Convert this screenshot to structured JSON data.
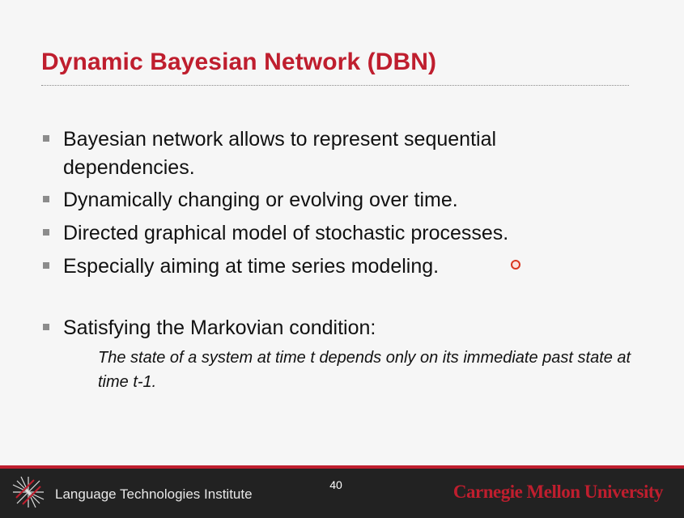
{
  "slide": {
    "title": "Dynamic Bayesian Network (DBN)",
    "bullets": [
      {
        "text": "Bayesian network allows to represent sequential dependencies."
      },
      {
        "text": "Dynamically changing or evolving over time."
      },
      {
        "text": "Directed graphical model of stochastic processes."
      },
      {
        "text": "Especially aiming at time series modeling."
      },
      {
        "text": "Satisfying the Markovian condition:"
      }
    ],
    "sub_text": "The state of a system at time t depends only on its immediate past state at time t-1."
  },
  "footer": {
    "institute": "Language Technologies Institute",
    "page_number": "40",
    "university": "Carnegie Mellon University",
    "logo_icon": "lti-network-logo"
  },
  "colors": {
    "title": "#bf1e2e",
    "footer_bg": "#222222",
    "accent": "#bf1e2e",
    "pointer": "#d9361f"
  }
}
